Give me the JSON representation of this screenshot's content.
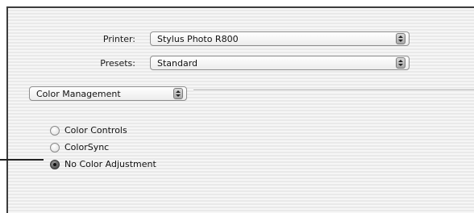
{
  "printer": {
    "label": "Printer:",
    "value": "Stylus Photo R800"
  },
  "presets": {
    "label": "Presets:",
    "value": "Standard"
  },
  "panel": {
    "value": "Color Management"
  },
  "options": [
    {
      "label": "Color Controls",
      "checked": false
    },
    {
      "label": "ColorSync",
      "checked": false
    },
    {
      "label": "No Color Adjustment",
      "checked": true
    }
  ],
  "icons": {
    "popup": "up-down-arrows-icon",
    "radio": "radio-button-icon"
  }
}
